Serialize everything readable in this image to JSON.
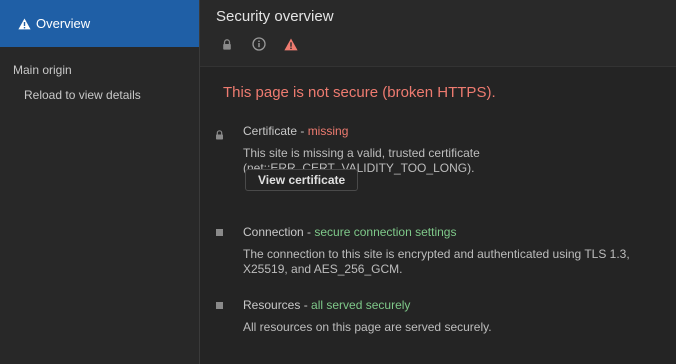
{
  "sidebar": {
    "overview_label": "Overview",
    "section_label": "Main origin",
    "sub_item_label": "Reload to view details"
  },
  "header": {
    "title": "Security overview",
    "icons": [
      "lock-icon",
      "info-icon",
      "warning-icon"
    ]
  },
  "summary": "This page is not secure (broken HTTPS).",
  "items": {
    "certificate": {
      "label": "Certificate - ",
      "status": "missing",
      "desc": "This site is missing a valid, trusted certificate (net::ERR_CERT_VALIDITY_TOO_LONG).",
      "button": "View certificate"
    },
    "connection": {
      "label": "Connection - ",
      "status": "secure connection settings",
      "desc": "The connection to this site is encrypted and authenticated using TLS 1.3, X25519, and AES_256_GCM."
    },
    "resources": {
      "label": "Resources - ",
      "status": "all served securely",
      "desc": "All resources on this page are served securely."
    }
  },
  "colors": {
    "accent": "#1f5fa6",
    "bad": "#ee7b70",
    "good": "#7fc98a"
  }
}
